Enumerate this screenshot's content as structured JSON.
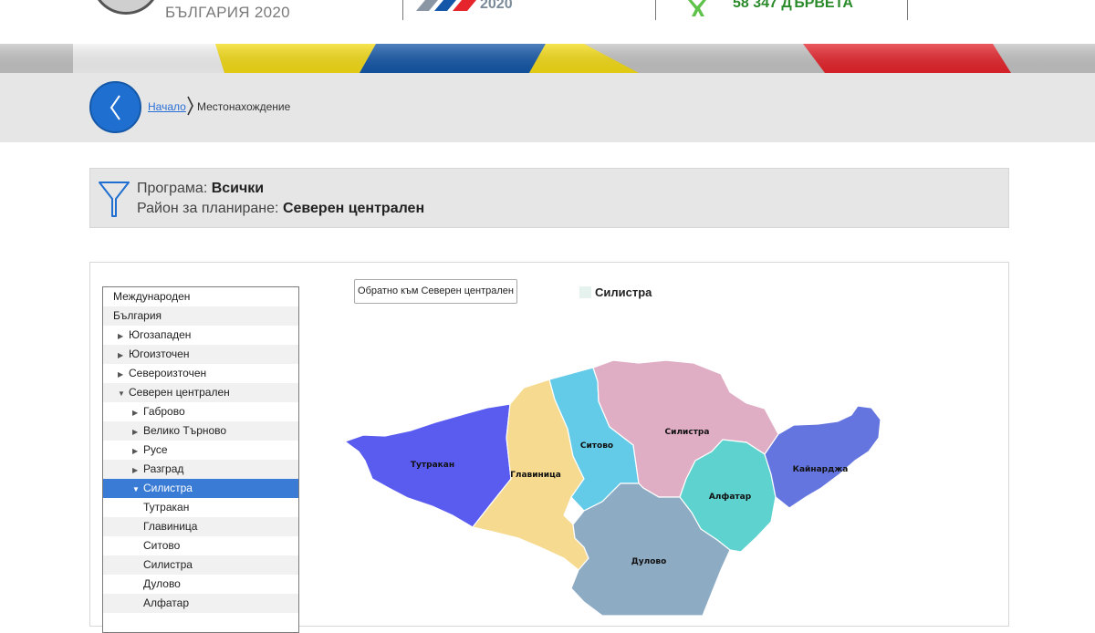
{
  "header": {
    "logo_text": "БЪЛГАРИЯ 2020",
    "logo2_year": "2020",
    "trees_count": "58 347 ДЪРВЕТА"
  },
  "breadcrumb": {
    "home": "Начало",
    "current": "Местонахождение"
  },
  "filter": {
    "program_label": "Програма: ",
    "program_value": "Всички",
    "region_label": "Район за планиране: ",
    "region_value": "Северен централен"
  },
  "tree": {
    "items": [
      {
        "label": "Международен"
      },
      {
        "label": "България"
      },
      {
        "label": "Югозападен"
      },
      {
        "label": "Югоизточен"
      },
      {
        "label": "Североизточен"
      },
      {
        "label": "Северен централен"
      },
      {
        "label": "Габрово"
      },
      {
        "label": "Велико Търново"
      },
      {
        "label": "Русе"
      },
      {
        "label": "Разград"
      },
      {
        "label": "Силистра"
      },
      {
        "label": "Тутракан"
      },
      {
        "label": "Главиница"
      },
      {
        "label": "Ситово"
      },
      {
        "label": "Силистра"
      },
      {
        "label": "Дулово"
      },
      {
        "label": "Алфатар"
      }
    ]
  },
  "map": {
    "back_button": "Обратно към Северен централен",
    "legend_label": "Силистра",
    "legend_color": "#e6f2ee",
    "regions": [
      {
        "name": "Тутракан",
        "color": "#5a5cf0"
      },
      {
        "name": "Главиница",
        "color": "#f6da90"
      },
      {
        "name": "Ситово",
        "color": "#63cbe8"
      },
      {
        "name": "Силистра",
        "color": "#e0aec4"
      },
      {
        "name": "Алфатар",
        "color": "#5ed2ce"
      },
      {
        "name": "Кайнарджа",
        "color": "#6475e0"
      },
      {
        "name": "Дулово",
        "color": "#8eabc4"
      }
    ]
  },
  "colors": {
    "accent_blue": "#1f6fd1",
    "selected_bg": "#3a7bd5",
    "stripe_yellow": "#f5dc16",
    "stripe_blue": "#1457a8",
    "stripe_red": "#e5242b"
  }
}
